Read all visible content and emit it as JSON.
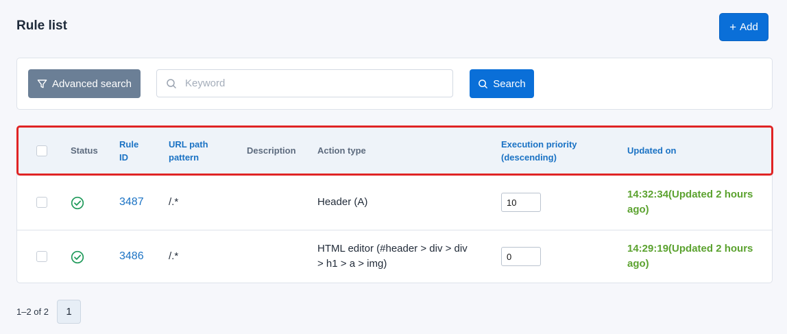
{
  "page": {
    "title": "Rule list"
  },
  "toolbar": {
    "add_label": "Add"
  },
  "search": {
    "advanced_label": "Advanced search",
    "keyword_placeholder": "Keyword",
    "keyword_value": "",
    "search_label": "Search"
  },
  "table": {
    "headers": {
      "status": "Status",
      "rule_id_1": "Rule",
      "rule_id_2": "ID",
      "url_1": "URL path",
      "url_2": "pattern",
      "description": "Description",
      "action_type": "Action type",
      "priority_1": "Execution priority",
      "priority_2": "(descending)",
      "updated": "Updated on"
    },
    "rows": [
      {
        "status": "enabled",
        "rule_id": "3487",
        "url_pattern": "/.*",
        "description": "",
        "action_1": "Header (A)",
        "action_2": "",
        "priority": "10",
        "updated_1": "14:32:34(Updated 2 hours",
        "updated_2": "ago)"
      },
      {
        "status": "enabled",
        "rule_id": "3486",
        "url_pattern": "/.*",
        "description": "",
        "action_1": "HTML editor (#header > div > div",
        "action_2": "> h1 > a > img)",
        "priority": "0",
        "updated_1": "14:29:19(Updated 2 hours",
        "updated_2": "ago)"
      }
    ]
  },
  "pagination": {
    "info": "1–2 of 2",
    "current_page": "1"
  },
  "icons": {
    "add": "plus-icon",
    "advanced": "filter-icon",
    "search": "search-icon",
    "status": "check-circle-icon"
  },
  "colors": {
    "primary": "#0a6fd8",
    "secondary": "#6b7f96",
    "success": "#1f9a5a",
    "updated_text": "#5ba22f",
    "highlight": "#e02424"
  }
}
